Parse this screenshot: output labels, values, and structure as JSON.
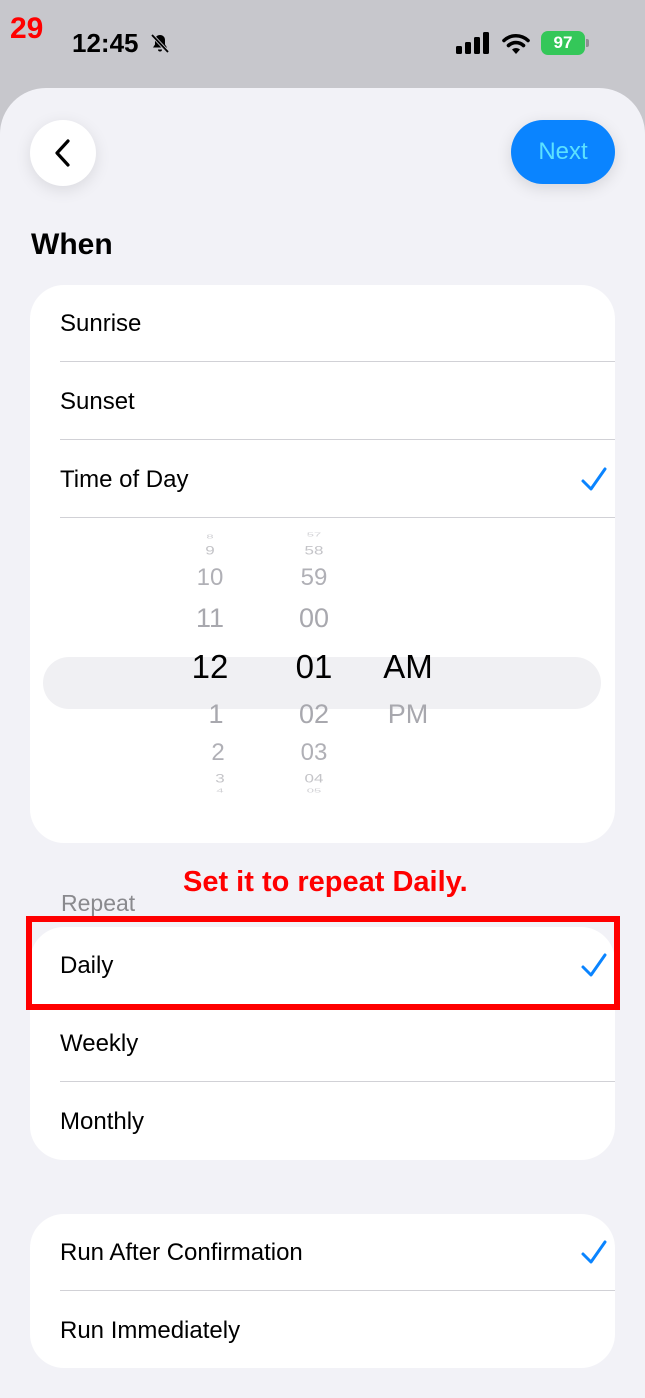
{
  "annotation": {
    "step": "29",
    "instruction": "Set it to repeat Daily."
  },
  "status_bar": {
    "time": "12:45",
    "battery": "97"
  },
  "header": {
    "next_label": "Next"
  },
  "when": {
    "title": "When",
    "options": [
      {
        "label": "Sunrise",
        "checked": false
      },
      {
        "label": "Sunset",
        "checked": false
      },
      {
        "label": "Time of Day",
        "checked": true
      }
    ]
  },
  "time_picker": {
    "hours": {
      "above": [
        "8",
        "9",
        "10",
        "11"
      ],
      "selected": "12",
      "below": [
        "1",
        "2",
        "3",
        "4"
      ]
    },
    "minutes": {
      "above": [
        "57",
        "58",
        "59",
        "00"
      ],
      "selected": "01",
      "below": [
        "02",
        "03",
        "04",
        "05"
      ]
    },
    "period": {
      "selected": "AM",
      "below": [
        "PM"
      ]
    }
  },
  "repeat": {
    "title": "Repeat",
    "options": [
      {
        "label": "Daily",
        "checked": true
      },
      {
        "label": "Weekly",
        "checked": false
      },
      {
        "label": "Monthly",
        "checked": false
      }
    ]
  },
  "run_mode": {
    "options": [
      {
        "label": "Run After Confirmation",
        "checked": true
      },
      {
        "label": "Run Immediately",
        "checked": false
      }
    ]
  },
  "colors": {
    "accent": "#0a84ff",
    "annotation": "#ff0000",
    "battery": "#34c759"
  }
}
